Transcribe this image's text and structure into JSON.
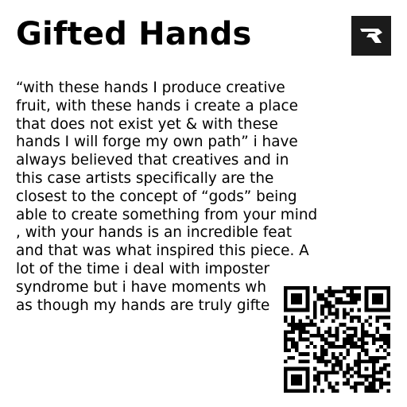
{
  "header": {
    "title": "Gifted Hands"
  },
  "logo": {
    "icon": "brand-logo-icon",
    "background": "#1b1b1b"
  },
  "description": {
    "text": "“with these hands I produce creative\nfruit, with these hands i create a place\nthat does not exist yet & with these\nhands I will forge my own path” i have\nalways believed that creatives and in\nthis case artists specifically are the\nclosest to the concept of “gods” being\nable to create something from your mind\n, with your hands is an incredible feat\nand that was what inspired this piece. A\nlot of the time i deal with imposter\nsyndrome but i have moments wh\nas though my hands are truly gifte"
  },
  "qr": {
    "icon": "qr-code-icon"
  }
}
